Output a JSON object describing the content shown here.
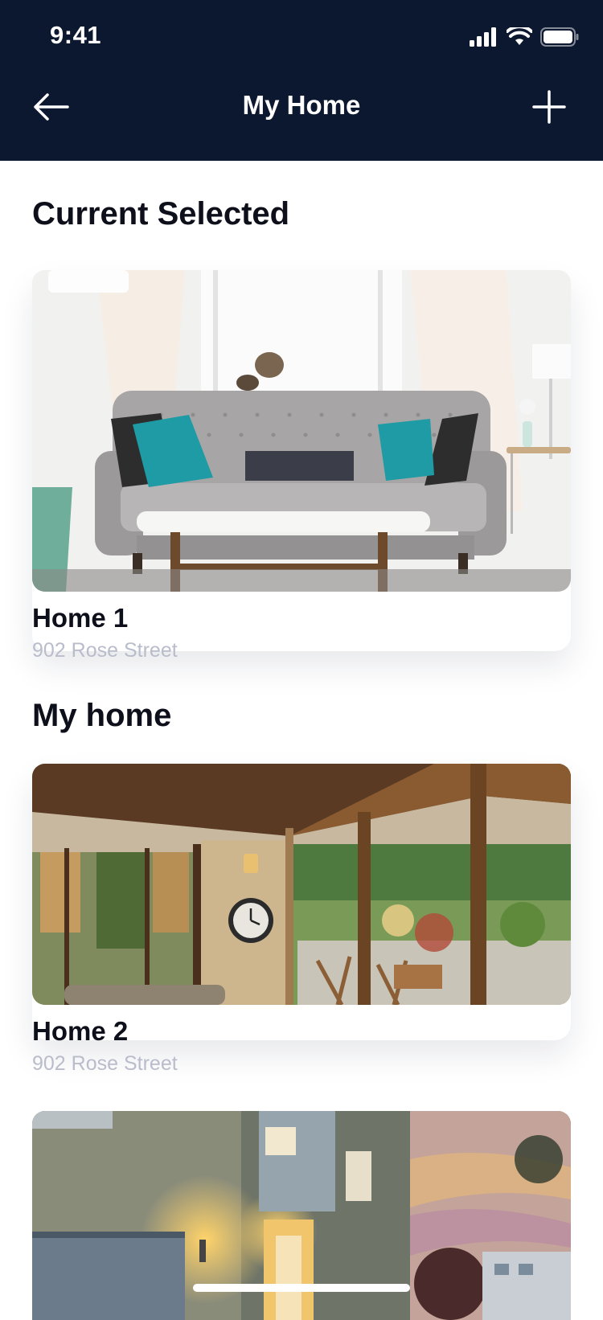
{
  "status_bar": {
    "time": "9:41"
  },
  "nav": {
    "title": "My Home"
  },
  "sections": {
    "current_title": "Current Selected",
    "my_home_title": "My home"
  },
  "homes": [
    {
      "name": "Home 1",
      "address": "902 Rose Street"
    },
    {
      "name": "Home 2",
      "address": "902 Rose Street"
    }
  ],
  "colors": {
    "topbar": "#0c1730",
    "title_text": "#0d0f1a",
    "address_text": "#b9bccb"
  }
}
